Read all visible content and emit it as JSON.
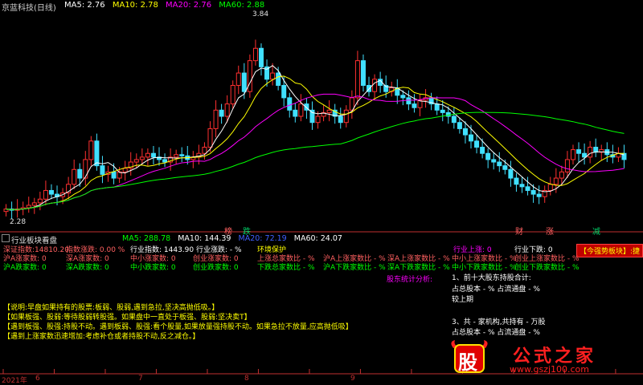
{
  "header": {
    "title": "京蓝科技(日线)",
    "ma": [
      {
        "label": "MA5: 2.76",
        "color": "#ffffff"
      },
      {
        "label": "MA10: 2.78",
        "color": "#ffff00"
      },
      {
        "label": "MA20: 2.76",
        "color": "#ff00ff"
      },
      {
        "label": "MA60: 2.88",
        "color": "#00ff00"
      }
    ]
  },
  "chart_data": {
    "type": "line",
    "title": "",
    "price_high_label": "3.84",
    "price_low_label": "2.28",
    "markers": [
      {
        "text": "榜",
        "color": "#ff6060"
      },
      {
        "text": "跌",
        "color": "#00cc66"
      },
      {
        "text": "财",
        "color": "#ff6060"
      },
      {
        "text": "涨",
        "color": "#ff6060"
      },
      {
        "text": "减",
        "color": "#00cc66"
      }
    ],
    "x_ticks": [
      "2021年",
      "6",
      "7",
      "8",
      "9"
    ],
    "ylim": [
      2.2,
      3.9
    ],
    "closes": [
      2.3,
      2.29,
      2.3,
      2.31,
      2.33,
      2.35,
      2.38,
      2.45,
      2.42,
      2.4,
      2.43,
      2.5,
      2.62,
      2.55,
      2.7,
      2.85,
      2.65,
      2.58,
      2.6,
      2.55,
      2.6,
      2.63,
      2.68,
      2.7,
      2.72,
      2.75,
      2.72,
      2.7,
      2.68,
      2.72,
      2.74,
      2.73,
      2.7,
      2.72,
      2.75,
      2.8,
      2.95,
      3.1,
      3.05,
      3.15,
      3.3,
      3.4,
      3.25,
      3.5,
      3.6,
      3.45,
      3.35,
      3.4,
      3.3,
      3.2,
      3.1,
      3.05,
      3.15,
      3.1,
      3.0,
      3.05,
      3.08,
      3.1,
      3.05,
      3.0,
      3.1,
      3.2,
      3.5,
      3.3,
      3.25,
      3.35,
      3.3,
      3.25,
      3.28,
      3.22,
      3.2,
      3.15,
      3.12,
      3.18,
      3.2,
      3.15,
      3.1,
      3.08,
      3.05,
      3.0,
      2.95,
      2.9,
      2.85,
      2.8,
      2.75,
      2.7,
      2.68,
      2.65,
      2.62,
      2.55,
      2.5,
      2.48,
      2.45,
      2.42,
      2.4,
      2.45,
      2.5,
      2.55,
      2.6,
      2.7,
      2.78,
      2.75,
      2.72,
      2.8,
      2.76,
      2.78,
      2.74,
      2.72,
      2.75,
      2.7
    ],
    "series": [
      {
        "name": "MA5",
        "color": "#ffffff"
      },
      {
        "name": "MA10",
        "color": "#ffff00"
      },
      {
        "name": "MA20",
        "color": "#ff00ff"
      },
      {
        "name": "MA60",
        "color": "#00ff00"
      }
    ]
  },
  "panel": {
    "title": "行业板块看盘",
    "ma": [
      {
        "label": "MA5: 288.78",
        "color": "#00ff00"
      },
      {
        "label": "MA10: 144.39",
        "color": "#ffffff"
      },
      {
        "label": "MA20: 72.19",
        "color": "#ffffff"
      },
      {
        "label": "MA60: 24.07",
        "color": "#ffffff"
      }
    ],
    "tag": "【今强势板块】:捷"
  },
  "stats": {
    "r1": [
      {
        "text": "深证指数:14810.20",
        "color": "#ff6060"
      },
      {
        "text": "指数涨跌: 0.00 %",
        "color": "#ff6060"
      },
      {
        "text": "行业指数: 1443.90",
        "color": "#ffffff"
      },
      {
        "text": "行业涨跌: - %",
        "color": "#ffffff"
      },
      {
        "text": "环境保护",
        "color": "#ffff00"
      },
      {
        "text": "行业上涨: 0",
        "color": "#ff00ff"
      },
      {
        "text": "行业下跌: 0",
        "color": "#ffffff"
      }
    ],
    "r2": [
      {
        "text": "沪A涨家数: 0",
        "color": "#ff6060"
      },
      {
        "text": "深A涨家数: 0",
        "color": "#ff6060"
      },
      {
        "text": "中小涨家数: 0",
        "color": "#ff6060"
      },
      {
        "text": "创业涨家数: 0",
        "color": "#ff6060"
      },
      {
        "text": "上涨总家数比 - %",
        "color": "#ff6060"
      },
      {
        "text": "沪A上涨家数比 - %",
        "color": "#ff6060"
      },
      {
        "text": "深A上涨家数比 - %",
        "color": "#ff6060"
      },
      {
        "text": "中小上涨家数比 - %",
        "color": "#ff6060"
      },
      {
        "text": "创业上涨家数比 - %",
        "color": "#ff6060"
      }
    ],
    "r3": [
      {
        "text": "沪A跌家数: 0",
        "color": "#00ff00"
      },
      {
        "text": "深A跌家数: 0",
        "color": "#00ff00"
      },
      {
        "text": "中小跌家数: 0",
        "color": "#00ff00"
      },
      {
        "text": "创业跌家数: 0",
        "color": "#00ff00"
      },
      {
        "text": "下跌总家数比 - %",
        "color": "#00ff00"
      },
      {
        "text": "沪A下跌家数比 - %",
        "color": "#00ff00"
      },
      {
        "text": "深A下跌家数比 - %",
        "color": "#00ff00"
      },
      {
        "text": "中小下跌家数比 - %",
        "color": "#00ff00"
      },
      {
        "text": "创业下跌家数比 - %",
        "color": "#00ff00"
      }
    ],
    "shareholder_title": "股东统计分析:",
    "sh_lines": [
      "1、前十大股东持股合计:",
      "占总股本 - %  占流通盘 - %",
      "较上期",
      "",
      "3、共 - 家机构,共持有 - 万股",
      "占总股本 - %  占流通盘 - %"
    ]
  },
  "notes": [
    "【说明:早盘如果持有的股票:板弱、股弱,遇到急拉,坚决高抛低吸。】",
    "【如果板强、股弱:等待股弱转股强。如果盘中一直处于板强、股弱:坚决卖T】",
    "【遇到板强、股强:持股不动。遇到板弱、股强:看个股量,如果放量强持股不动。如果急拉不放量,应高抛低吸】",
    "【遇到上涨家数迅速增加:考虑补仓或者持股不动,反之减仓。】"
  ],
  "watermark": {
    "badge": "股",
    "name": "公式之家",
    "url": "www.gszj100.com"
  }
}
